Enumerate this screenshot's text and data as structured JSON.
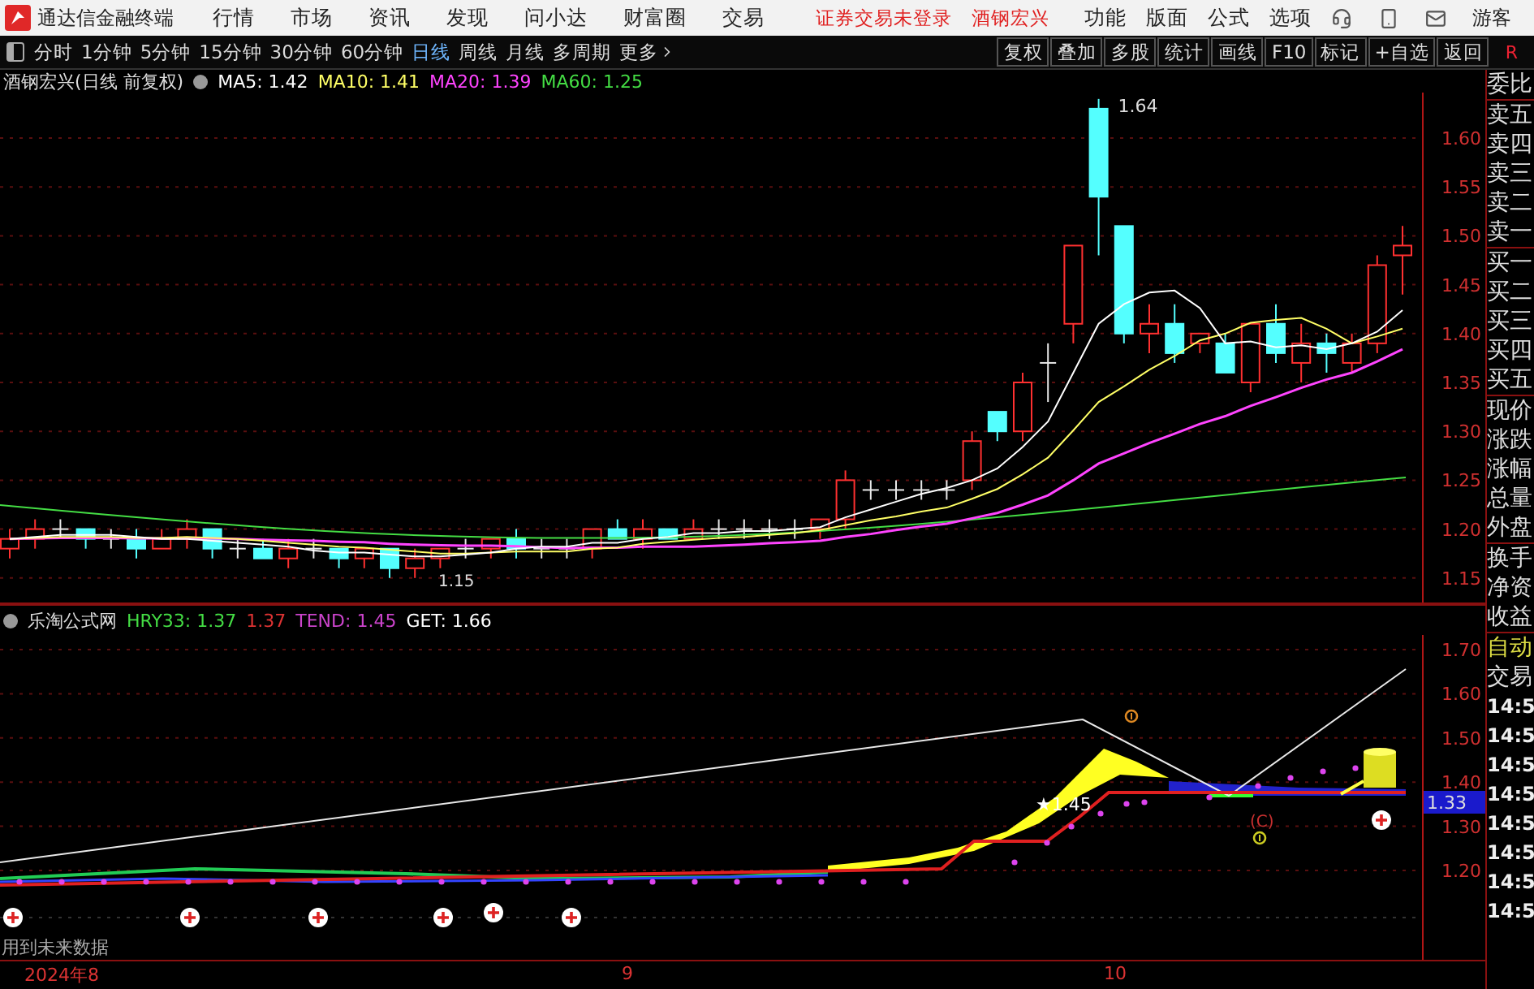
{
  "app": {
    "title": "通达信金融终端"
  },
  "menu": [
    "行情",
    "市场",
    "资讯",
    "发现",
    "问小达",
    "财富圈",
    "交易"
  ],
  "login_status": "证券交易未登录",
  "stock_name": "酒钢宏兴",
  "menu_right": [
    "功能",
    "版面",
    "公式",
    "选项"
  ],
  "user": "游客",
  "periods": [
    {
      "label": "分时",
      "selected": false
    },
    {
      "label": "1分钟",
      "selected": false
    },
    {
      "label": "5分钟",
      "selected": false
    },
    {
      "label": "15分钟",
      "selected": false
    },
    {
      "label": "30分钟",
      "selected": false
    },
    {
      "label": "60分钟",
      "selected": false
    },
    {
      "label": "日线",
      "selected": true
    },
    {
      "label": "周线",
      "selected": false
    },
    {
      "label": "月线",
      "selected": false
    },
    {
      "label": "多周期",
      "selected": false
    }
  ],
  "more": "更多",
  "tools": [
    "复权",
    "叠加",
    "多股",
    "统计",
    "画线",
    "F10",
    "标记",
    "+自选",
    "返回"
  ],
  "corner_mark": "R",
  "main_chart": {
    "title": "酒钢宏兴(日线 前复权)",
    "indicators": [
      {
        "text": "MA5: 1.42",
        "color": "#ffffff"
      },
      {
        "text": "MA10: 1.41",
        "color": "#ffff66"
      },
      {
        "text": "MA20: 1.39",
        "color": "#ff44ff"
      },
      {
        "text": "MA60: 1.25",
        "color": "#44dd44"
      }
    ],
    "ticks": [
      "1.60",
      "1.55",
      "1.50",
      "1.45",
      "1.40",
      "1.35",
      "1.30",
      "1.25",
      "1.20",
      "1.15"
    ],
    "high_label": "1.64",
    "low_label": "1.15"
  },
  "sub_chart": {
    "title": "乐淘公式网",
    "indicators": [
      {
        "text": "HRY33: 1.37",
        "color": "#44dd44"
      },
      {
        "text": "1.37",
        "color": "#dd3333"
      },
      {
        "text": "TEND: 1.45",
        "color": "#cc44cc"
      },
      {
        "text": "GET: 1.66",
        "color": "#ffffff"
      }
    ],
    "ticks": [
      "1.70",
      "1.60",
      "1.50",
      "1.40",
      "1.30",
      "1.20"
    ],
    "current_value": "1.33",
    "signal_label": "★1.45",
    "c_label": "(C)",
    "note": "用到未来数据"
  },
  "dates": [
    "2024年8",
    "9",
    "10"
  ],
  "quote_panel": {
    "groups": [
      {
        "labels": [
          "委比"
        ]
      },
      {
        "labels": [
          "卖五",
          "卖四",
          "卖三",
          "卖二",
          "卖一"
        ]
      },
      {
        "labels": [
          "买一",
          "买二",
          "买三",
          "买四",
          "买五"
        ]
      },
      {
        "labels": [
          "现价",
          "涨跌",
          "涨幅",
          "总量",
          "外盘"
        ]
      },
      {
        "labels": [
          "换手",
          "净资",
          "收益"
        ]
      }
    ],
    "auto": "自动",
    "trade": "交易",
    "times": [
      "14:5",
      "14:5",
      "14:5",
      "14:5",
      "14:5",
      "14:5",
      "14:5",
      "14:5"
    ]
  }
}
